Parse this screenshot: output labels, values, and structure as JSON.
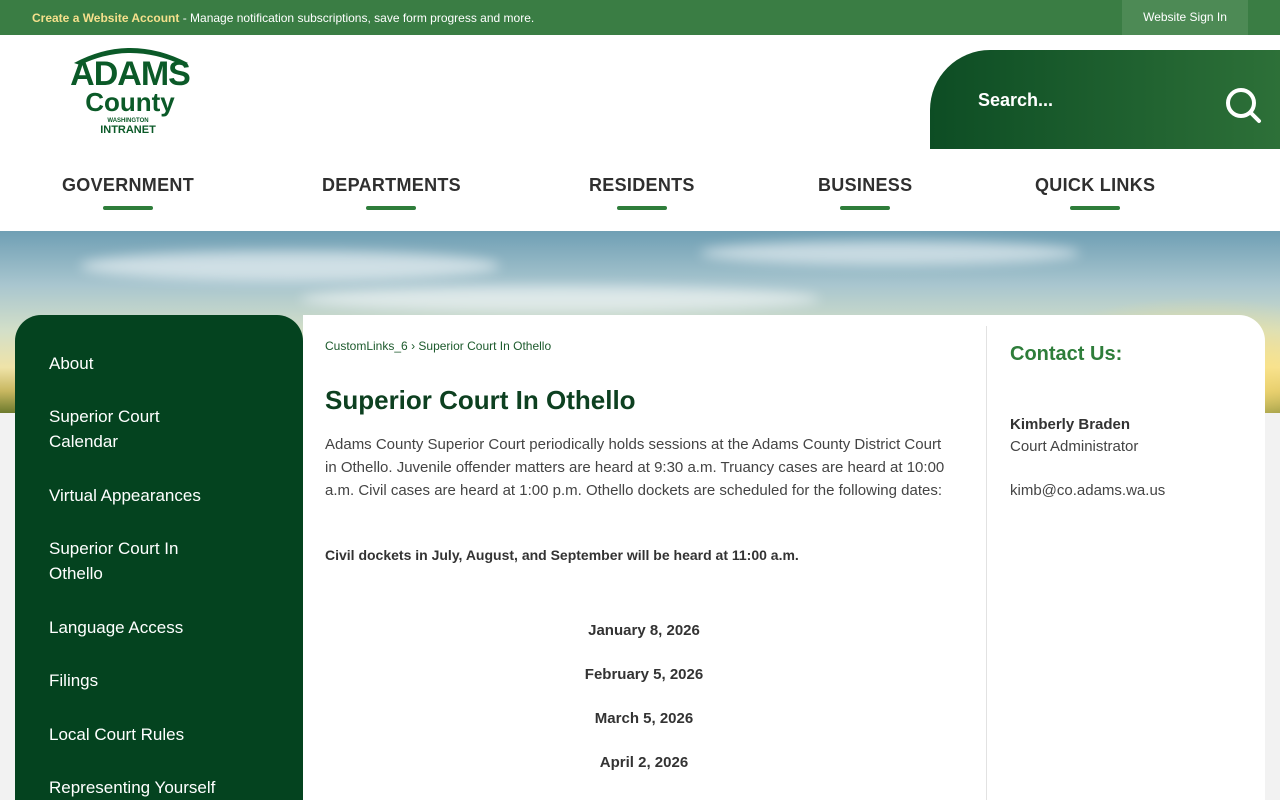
{
  "topbar": {
    "create_account": "Create a Website Account",
    "message": " - Manage notification subscriptions, save form progress and more.",
    "sign_in": "Website Sign In"
  },
  "logo": {
    "line1": "ADAMS",
    "line2": "County",
    "line3": "WASHINGTON",
    "line4": "INTRANET"
  },
  "search": {
    "placeholder": "Search...",
    "icon": "search-icon"
  },
  "nav": [
    "GOVERNMENT",
    "DEPARTMENTS",
    "RESIDENTS",
    "BUSINESS",
    "QUICK LINKS"
  ],
  "sidebar": [
    "About",
    "Superior Court Calendar",
    "Virtual Appearances",
    "Superior Court In Othello",
    "Language Access",
    "Filings",
    "Local Court Rules",
    "Representing Yourself"
  ],
  "breadcrumb": {
    "parent": "CustomLinks_6",
    "separator": "›",
    "current": "Superior Court In Othello"
  },
  "page": {
    "title": "Superior Court In Othello",
    "body": "Adams County Superior Court periodically holds sessions at the Adams County District Court in Othello. Juvenile offender matters are heard at 9:30 a.m. Truancy cases are heard at 10:00 a.m. Civil cases are heard at 1:00 p.m. Othello dockets are scheduled for the following dates:",
    "notice": "Civil dockets in July, August, and September will be heard at 11:00 a.m.",
    "dates": [
      "January 8, 2026",
      "February 5, 2026",
      "March 5, 2026",
      "April 2, 2026"
    ]
  },
  "contact": {
    "title": "Contact Us:",
    "name": "Kimberly Braden",
    "role": "Court Administrator",
    "email": "kimb@co.adams.wa.us"
  },
  "colors": {
    "topbar": "#3a7d44",
    "accent": "#2e7d3a",
    "sidebar": "#04431f",
    "title": "#0d4020"
  }
}
